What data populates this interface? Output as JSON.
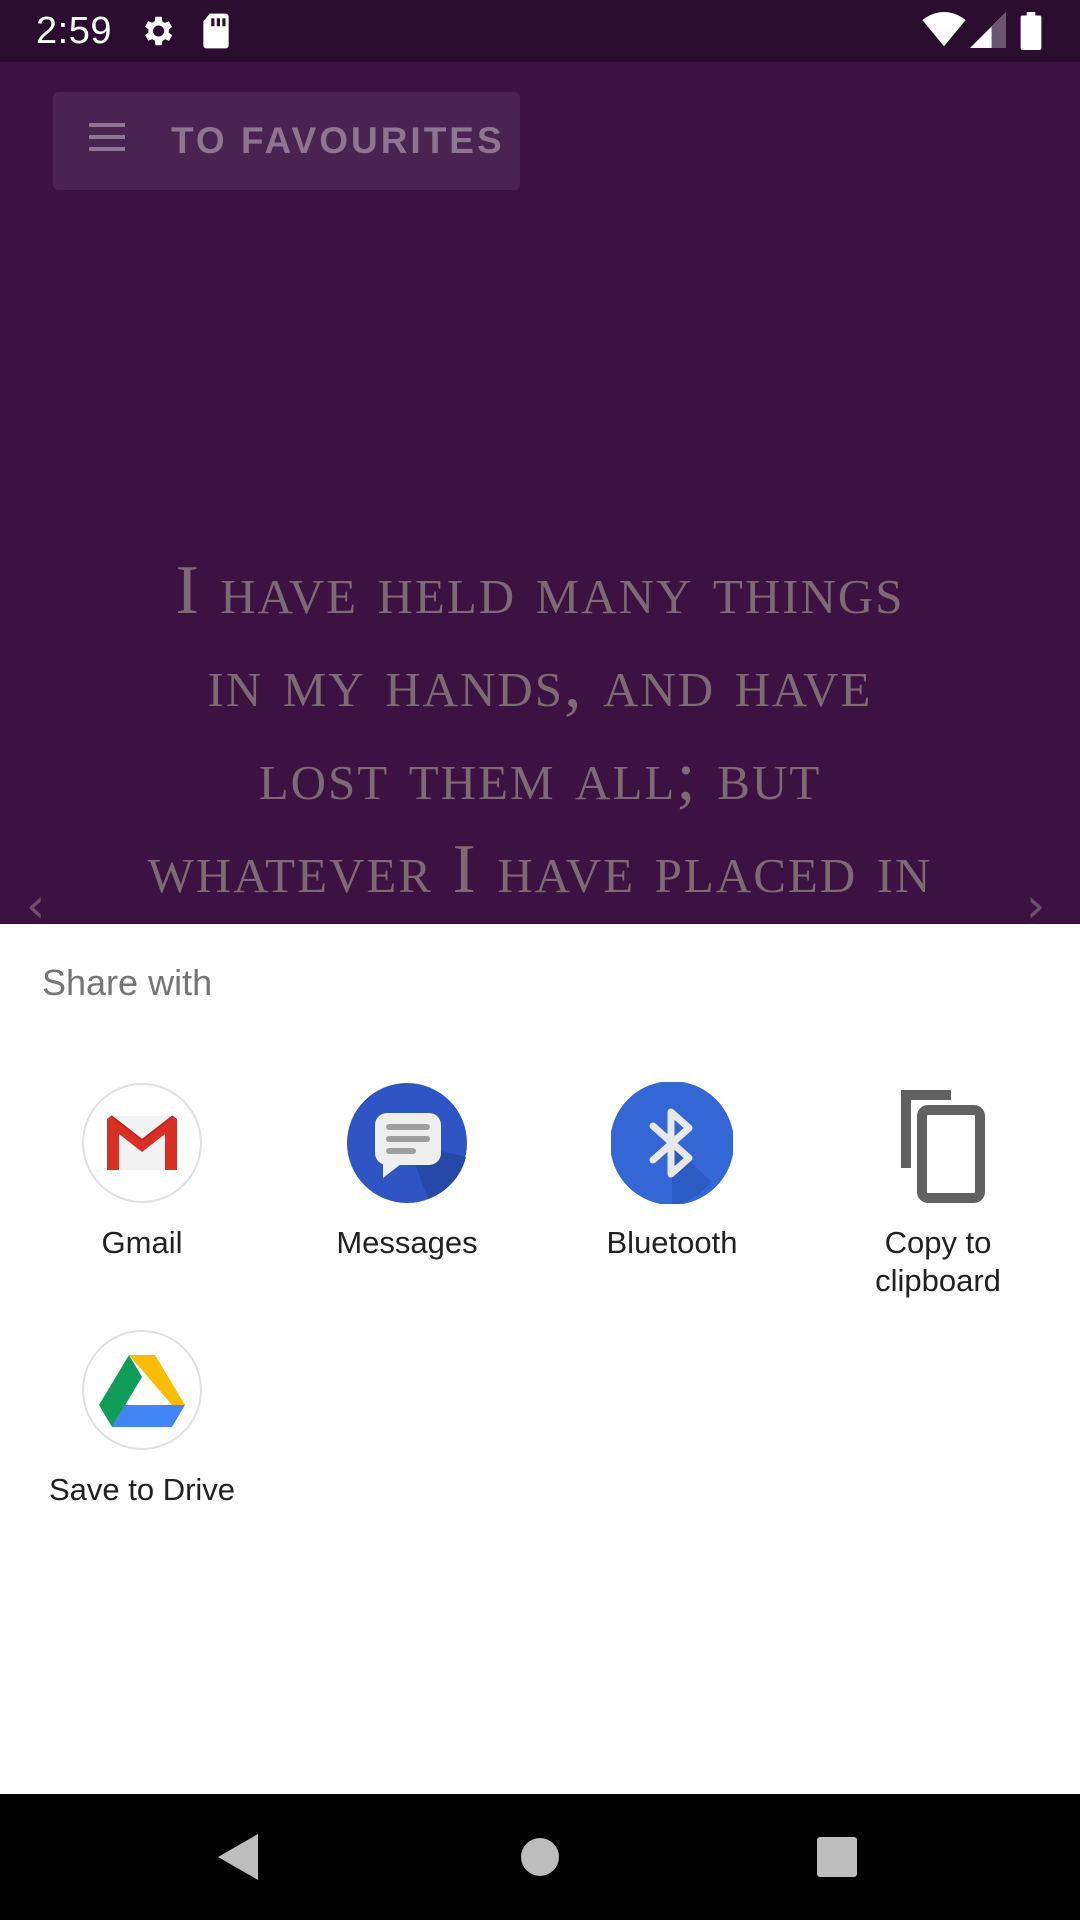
{
  "status_bar": {
    "time": "2:59",
    "icons": [
      "settings-icon",
      "sd-card-icon",
      "wifi-icon",
      "cellular-signal-icon",
      "battery-icon"
    ]
  },
  "app": {
    "favourites_button": "TO FAVOURITES",
    "quote": "I have held many things\nin my hands, and have\nlost them all;   but\nwhatever I have placed in",
    "prev_arrow": "‹",
    "next_arrow": "›"
  },
  "share_sheet": {
    "title": "Share with",
    "targets": [
      {
        "label": "Gmail",
        "icon": "gmail-icon"
      },
      {
        "label": "Messages",
        "icon": "messages-icon"
      },
      {
        "label": "Bluetooth",
        "icon": "bluetooth-icon"
      },
      {
        "label": "Copy to\nclipboard",
        "icon": "copy-icon"
      },
      {
        "label": "Save to Drive",
        "icon": "drive-icon"
      }
    ]
  },
  "nav_bar": {
    "buttons": [
      "back-icon",
      "home-icon",
      "recents-icon"
    ]
  },
  "colors": {
    "status_bar": "#2a0d2f",
    "app_background": "#3c1243",
    "sheet_background": "#ffffff",
    "messages_blue": "#2f55c4",
    "bluetooth_blue": "#3367d6"
  }
}
